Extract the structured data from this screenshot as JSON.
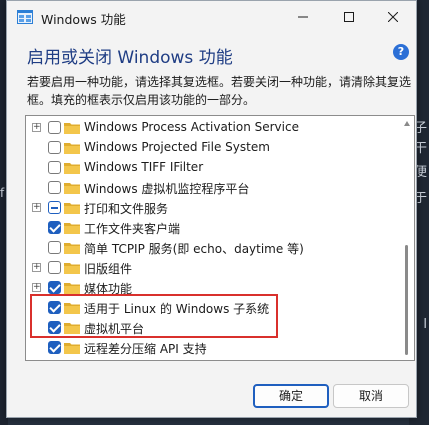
{
  "window": {
    "title": "Windows 功能"
  },
  "dialog": {
    "heading": "启用或关闭 Windows 功能",
    "description": "若要启用一种功能，请选择其复选框。若要关闭一种功能，请清除其复选框。填充的框表示仅启用该功能的一部分。"
  },
  "features": [
    {
      "label": "Windows Process Activation Service",
      "state": "unchecked",
      "expandable": true
    },
    {
      "label": "Windows Projected File System",
      "state": "unchecked",
      "expandable": false
    },
    {
      "label": "Windows TIFF IFilter",
      "state": "unchecked",
      "expandable": false
    },
    {
      "label": "Windows 虚拟机监控程序平台",
      "state": "unchecked",
      "expandable": false
    },
    {
      "label": "打印和文件服务",
      "state": "partial",
      "expandable": true
    },
    {
      "label": "工作文件夹客户端",
      "state": "checked",
      "expandable": false
    },
    {
      "label": "简单 TCPIP 服务(即 echo、daytime 等)",
      "state": "unchecked",
      "expandable": false
    },
    {
      "label": "旧版组件",
      "state": "unchecked",
      "expandable": true
    },
    {
      "label": "媒体功能",
      "state": "checked",
      "expandable": true
    },
    {
      "label": "适用于 Linux 的 Windows 子系统",
      "state": "checked",
      "expandable": false
    },
    {
      "label": "虚拟机平台",
      "state": "checked",
      "expandable": false
    },
    {
      "label": "远程差分压缩 API 支持",
      "state": "checked",
      "expandable": false
    }
  ],
  "buttons": {
    "ok": "确定",
    "cancel": "取消"
  },
  "background_glyphs": [
    "子",
    "干",
    "f",
    "便",
    "于",
    "w",
    "l"
  ],
  "colors": {
    "accent": "#1f5fbf",
    "highlight_box": "#d9302c",
    "heading": "#1f3d84",
    "folder": "#f3c64b"
  }
}
